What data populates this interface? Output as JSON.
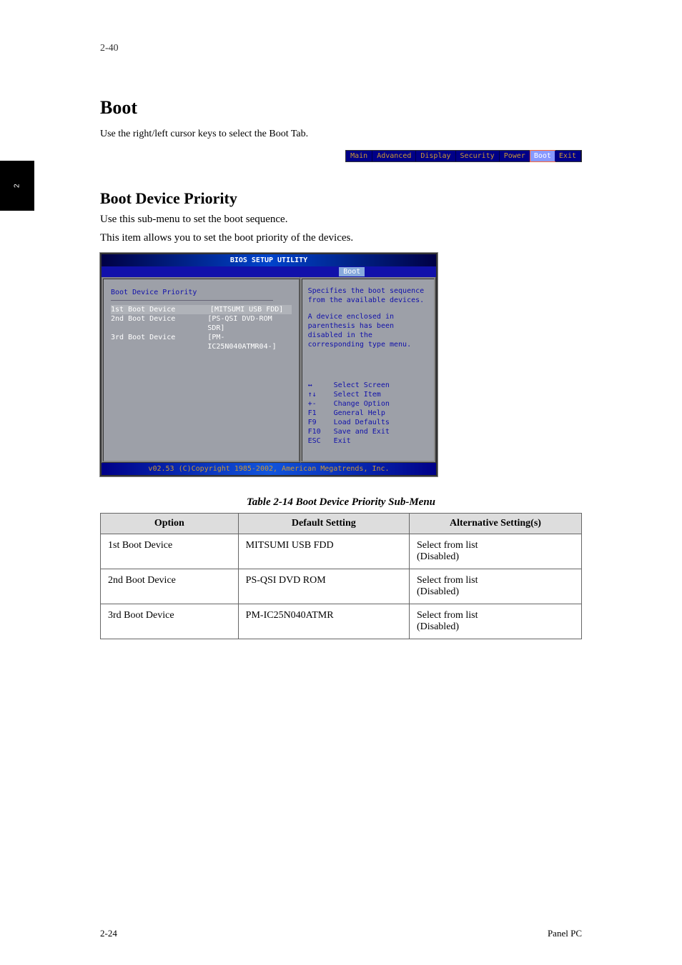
{
  "page_number_top": "2-40",
  "side_tab": "2",
  "section": {
    "title": "Boot",
    "subtitle": "Use the right/left cursor keys to select the Boot Tab."
  },
  "tab_strip": [
    "Main",
    "Advanced",
    "Display",
    "Security",
    "Power",
    "Boot",
    "Exit"
  ],
  "tab_strip_selected": "Boot",
  "subsection": {
    "title": "Boot Device Priority",
    "para1": "Use this sub-menu to set the boot sequence.",
    "para2": "This item allows you to set the boot priority of the devices."
  },
  "bios": {
    "title": "BIOS SETUP UTILITY",
    "active_tab": "Boot",
    "left": {
      "heading": "Boot Device Priority",
      "rows": [
        {
          "label": "1st Boot Device",
          "value": "[MITSUMI USB FDD]"
        },
        {
          "label": "2nd Boot Device",
          "value": "[PS-QSI DVD-ROM SDR]"
        },
        {
          "label": "3rd Boot Device",
          "value": "[PM-IC25N040ATMR04-]"
        }
      ]
    },
    "right": {
      "para1": "Specifies the boot sequence from the available devices.",
      "para2": "A device enclosed in parenthesis has been disabled in the corresponding type menu.",
      "keys": [
        {
          "k": "↔",
          "d": "Select Screen"
        },
        {
          "k": "↑↓",
          "d": "Select Item"
        },
        {
          "k": "+-",
          "d": "Change Option"
        },
        {
          "k": "F1",
          "d": "General Help"
        },
        {
          "k": "F9",
          "d": "Load Defaults"
        },
        {
          "k": "F10",
          "d": "Save and Exit"
        },
        {
          "k": "ESC",
          "d": "Exit"
        }
      ]
    },
    "footer": "v02.53 (C)Copyright 1985-2002, American Megatrends, Inc."
  },
  "table": {
    "caption": "Table 2-14 Boot Device Priority Sub-Menu",
    "headers": [
      "Option",
      "Default Setting",
      "Alternative Setting(s)"
    ],
    "rows": [
      {
        "option": "1st Boot Device",
        "default": "MITSUMI USB FDD",
        "alt": "Select from list\n(Disabled)"
      },
      {
        "option": "2nd Boot Device",
        "default": "PS-QSI DVD ROM",
        "alt": "Select from list\n(Disabled)"
      },
      {
        "option": "3rd Boot Device",
        "default": "PM-IC25N040ATMR",
        "alt": "Select from list\n(Disabled)"
      }
    ]
  },
  "footer_left": "2-24",
  "footer_right": "Panel PC"
}
